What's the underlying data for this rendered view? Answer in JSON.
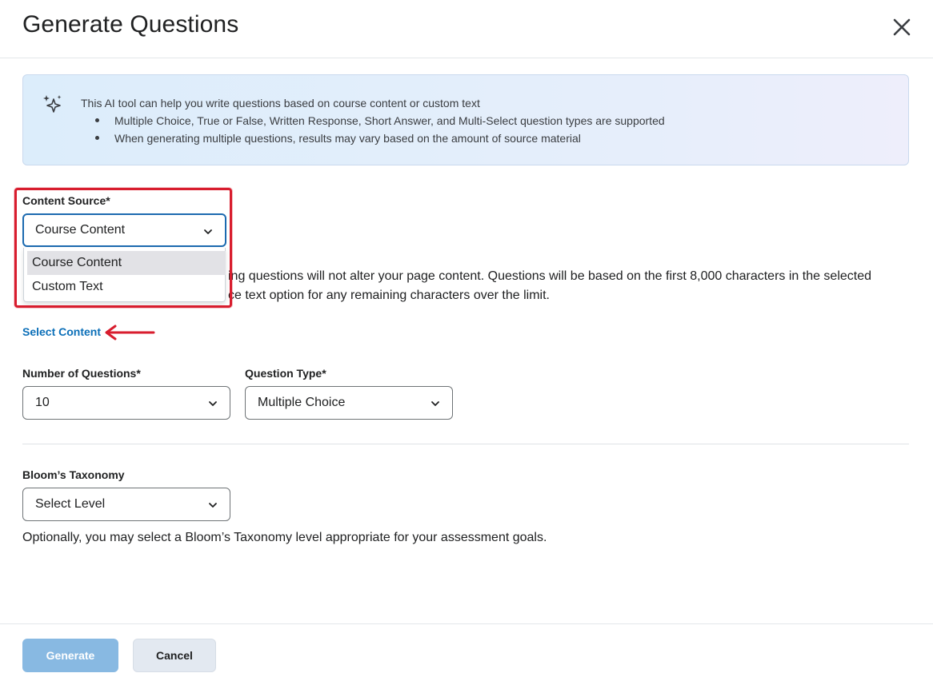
{
  "dialog": {
    "title": "Generate Questions",
    "close_icon": "close-icon"
  },
  "info": {
    "icon": "sparkle-icon",
    "intro": "This AI tool can help you write questions based on course content or custom text",
    "bullets": [
      "Multiple Choice, True or False, Written Response, Short Answer, and Multi-Select question types are supported",
      "When generating multiple questions, results may vary based on the amount of source material"
    ]
  },
  "content_source": {
    "label": "Content Source*",
    "selected": "Course Content",
    "options": [
      "Course Content",
      "Custom Text"
    ],
    "highlighted_option": "Course Content"
  },
  "content_description": {
    "line1": "ing questions will not alter your page content. Questions will be based on the first 8,000 characters in the selected",
    "line2": "ce text option for any remaining characters over the limit."
  },
  "select_content_link": "Select Content",
  "number_of_questions": {
    "label": "Number of Questions*",
    "selected": "10"
  },
  "question_type": {
    "label": "Question Type*",
    "selected": "Multiple Choice"
  },
  "blooms": {
    "label": "Bloom’s Taxonomy",
    "selected": "Select Level",
    "help": "Optionally, you may select a Bloom’s Taxonomy level appropriate for your assessment goals."
  },
  "footer": {
    "generate_label": "Generate",
    "cancel_label": "Cancel"
  },
  "colors": {
    "accent": "#1c6ab0",
    "link": "#0b6fb8",
    "annotation_red": "#d81d2e",
    "primary_button_disabled": "#88b9e2"
  }
}
